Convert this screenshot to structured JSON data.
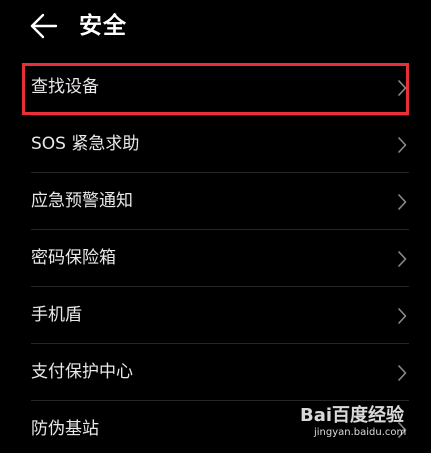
{
  "header": {
    "back_icon": "arrow-left-icon",
    "title": "安全"
  },
  "colors": {
    "background": "#000000",
    "text": "#ffffff",
    "highlight": "#e8303a",
    "chevron": "#8a8a8a"
  },
  "menu": {
    "items": [
      {
        "label": "查找设备",
        "icon": "chevron-right-icon"
      },
      {
        "label": "SOS 紧急求助",
        "icon": "chevron-right-icon"
      },
      {
        "label": "应急预警通知",
        "icon": "chevron-right-icon"
      },
      {
        "label": "密码保险箱",
        "icon": "chevron-right-icon"
      },
      {
        "label": "手机盾",
        "icon": "chevron-right-icon"
      },
      {
        "label": "支付保护中心",
        "icon": "chevron-right-icon"
      },
      {
        "label": "防伪基站",
        "icon": "chevron-right-icon"
      }
    ]
  },
  "watermark": {
    "logo": "Bai百度经验",
    "url": "jingyan.baidu.com"
  }
}
